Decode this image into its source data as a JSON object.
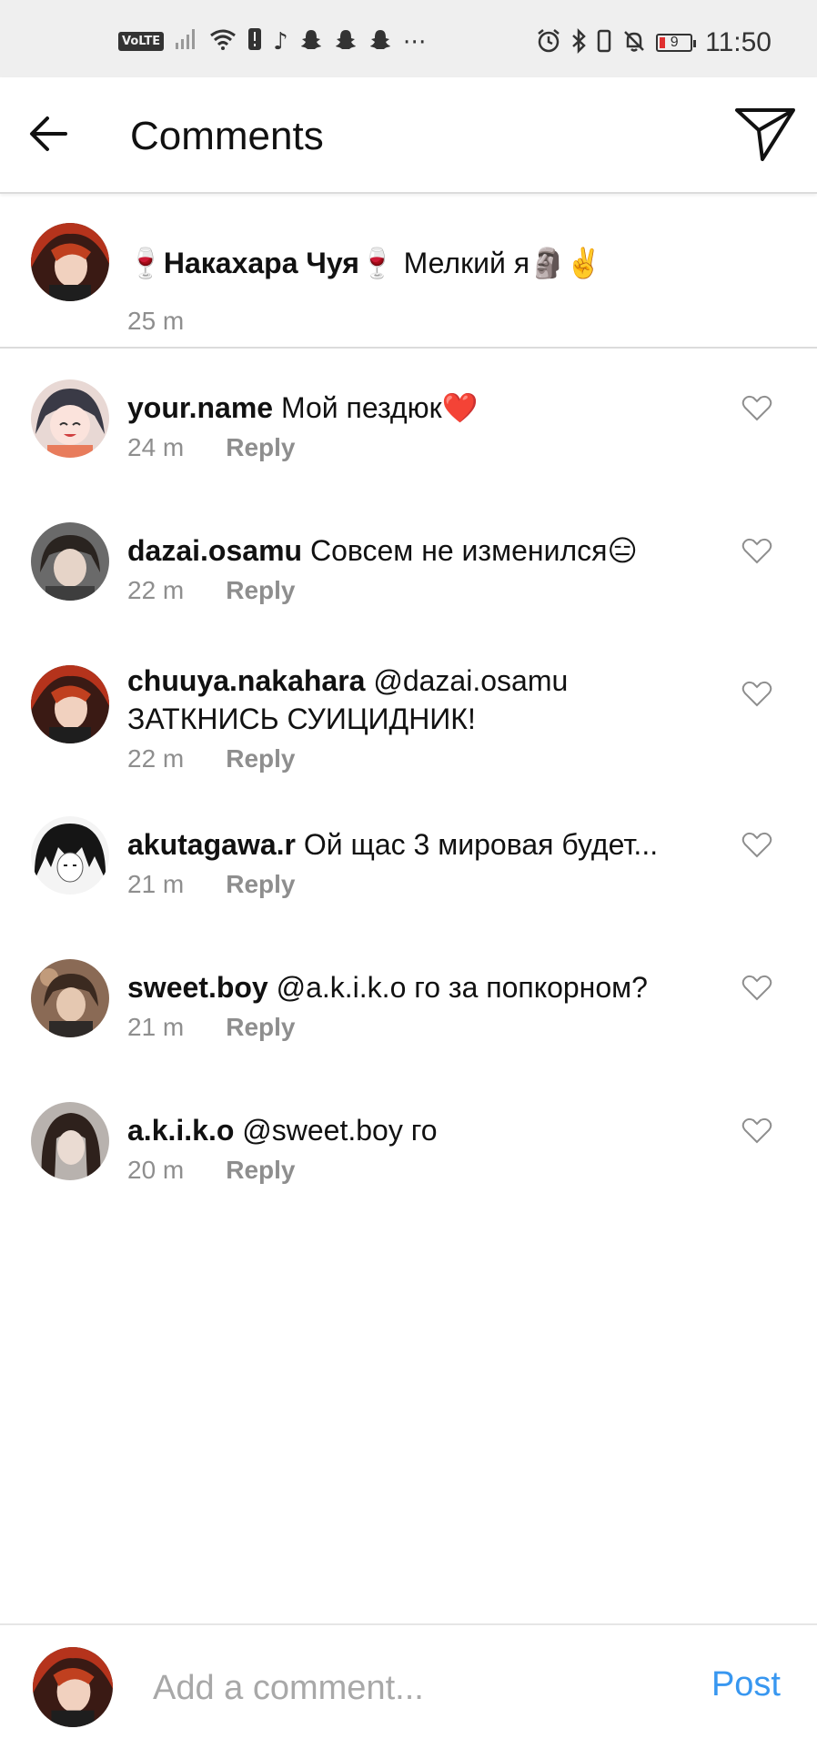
{
  "status_bar": {
    "network_badge": "VoLTE",
    "time": "11:50",
    "battery_level": "9",
    "left_icons": [
      "signal-icon",
      "wifi-icon",
      "alert-icon",
      "music-icon",
      "snapchat-icon",
      "snapchat-icon",
      "snapchat-icon",
      "more-icon"
    ],
    "right_icons": [
      "alarm-icon",
      "bluetooth-icon",
      "vibrate-icon",
      "mute-icon",
      "battery-icon"
    ]
  },
  "header": {
    "title": "Comments"
  },
  "caption": {
    "username": "🍷Накахара Чуя🍷",
    "text": " Мелкий я🗿✌️",
    "time": "25 m"
  },
  "comments": [
    {
      "username": "your.name",
      "text": " Мой пездюк❤️",
      "text2": "",
      "time": "24 m",
      "reply": "Reply"
    },
    {
      "username": "dazai.osamu",
      "text": " Совсем не изменился😑",
      "text2": "",
      "time": "22 m",
      "reply": "Reply"
    },
    {
      "username": "chuuya.nakahara",
      "text": " @dazai.osamu",
      "text2": "ЗАТКНИСЬ СУИЦИДНИК!",
      "time": "22 m",
      "reply": "Reply"
    },
    {
      "username": "akutagawa.r",
      "text": " Ой щас 3 мировая будет...",
      "text2": "",
      "time": "21 m",
      "reply": "Reply"
    },
    {
      "username": "sweet.boy",
      "text": " @a.k.i.k.o го за попкорном?",
      "text2": "",
      "time": "21 m",
      "reply": "Reply"
    },
    {
      "username": "a.k.i.k.o",
      "text": " @sweet.boy го",
      "text2": "",
      "time": "20 m",
      "reply": "Reply"
    }
  ],
  "footer": {
    "placeholder": "Add a comment...",
    "post_label": "Post"
  },
  "colors": {
    "accent": "#3897f0",
    "muted": "#8e8e8e",
    "status_bar_bg": "#efefef"
  }
}
